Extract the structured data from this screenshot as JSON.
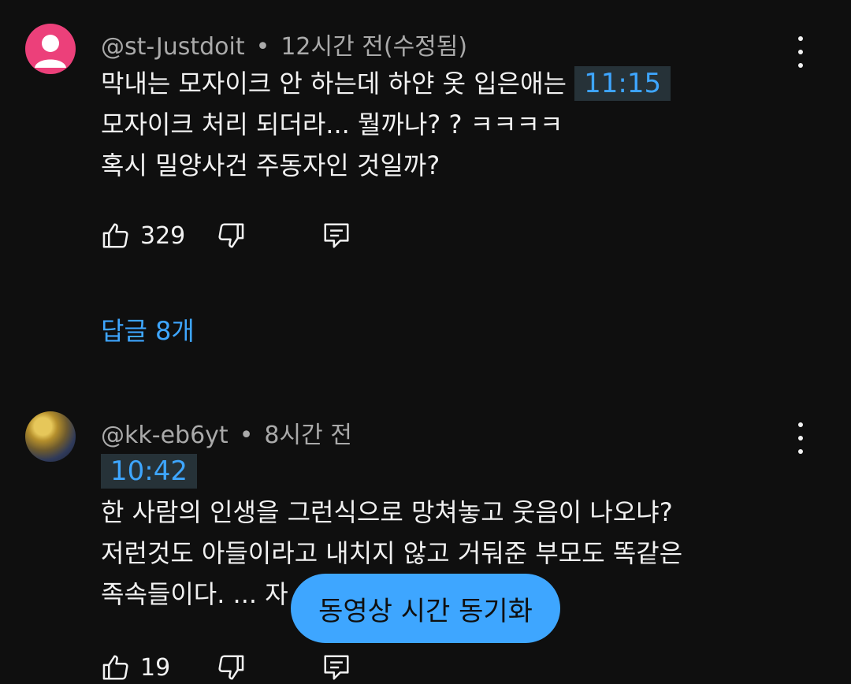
{
  "comments": [
    {
      "handle": "@st-Justdoit",
      "separator": "•",
      "time": "12시간 전",
      "edited": "(수정됨)",
      "line1": "막내는 모자이크 안 하는데 하얀 옷 입은애는",
      "timestamp": "11:15",
      "line2": "모자이크 처리 되더라... 뭘까나? ? ㅋㅋㅋㅋ",
      "line3": "혹시 밀양사건 주동자인 것일까?",
      "likes": "329",
      "replies": "답글 8개"
    },
    {
      "handle": "@kk-eb6yt",
      "separator": "•",
      "time": "8시간 전",
      "timestamp": "10:42",
      "line1": "한 사람의 인생을 그런식으로 망쳐놓고 웃음이 나오냐?",
      "line2": "저런것도 아들이라고 내치지 않고 거둬준 부모도 똑같은",
      "line3": "족속들이다. ... 자",
      "likes": "19"
    }
  ],
  "sync_button": "동영상 시간 동기화",
  "icons": {
    "like": "thumb-up-icon",
    "dislike": "thumb-down-icon",
    "reply": "reply-icon",
    "more": "more-vert-icon"
  },
  "colors": {
    "background": "#0f0f0f",
    "link": "#3ea6ff",
    "timestamp_bg": "#263238",
    "avatar_pink": "#ec407a"
  }
}
